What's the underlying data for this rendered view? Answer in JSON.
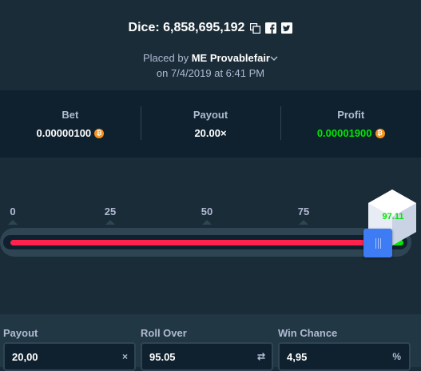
{
  "header": {
    "title": "Dice: 6,858,695,192",
    "copy_icon": "copy-icon",
    "facebook_icon": "facebook-icon",
    "twitter_icon": "twitter-icon",
    "placed_by_prefix": "Placed by",
    "user": "ME",
    "user_name": "Provablefair",
    "chevron_icon": "chevron-down-icon",
    "date_line": "on 7/4/2019 at 6:41 PM"
  },
  "stats": {
    "bet": {
      "label": "Bet",
      "value": "0.00000100"
    },
    "payout": {
      "label": "Payout",
      "value": "20.00×"
    },
    "profit": {
      "label": "Profit",
      "value": "0.00001900"
    },
    "coin_icon": "bitcoin-icon"
  },
  "slider": {
    "ticks": [
      "0",
      "25",
      "50",
      "75"
    ],
    "roll_over": 95.05,
    "result": "97.11",
    "handle_icon": "grip-icon",
    "colors": {
      "lose": "#ff224c",
      "win": "#00e701",
      "handle": "#3d7cf5"
    }
  },
  "controls": {
    "payout": {
      "label": "Payout",
      "value": "20,00",
      "icon": "×"
    },
    "roll_over": {
      "label": "Roll Over",
      "value": "95.05",
      "icon": "⇄"
    },
    "win_chance": {
      "label": "Win Chance",
      "value": "4,95",
      "icon": "%"
    }
  }
}
